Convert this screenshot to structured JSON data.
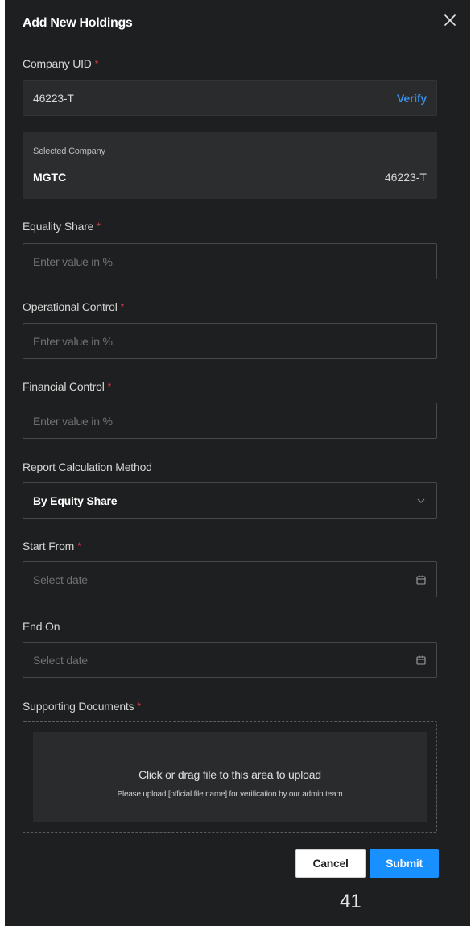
{
  "modal": {
    "title": "Add New Holdings"
  },
  "company_uid": {
    "label": "Company UID",
    "required_mark": "*",
    "value": "46223-T",
    "verify_label": "Verify"
  },
  "selected_company": {
    "caption": "Selected Company",
    "name": "MGTC",
    "code": "46223-T"
  },
  "equality_share": {
    "label": "Equality Share",
    "required_mark": "*",
    "placeholder": "Enter value in %"
  },
  "operational_control": {
    "label": "Operational Control",
    "required_mark": "*",
    "placeholder": "Enter value in %"
  },
  "financial_control": {
    "label": "Financial Control",
    "required_mark": "*",
    "placeholder": "Enter value in %"
  },
  "report_method": {
    "label": "Report Calculation Method",
    "selected": "By Equity Share"
  },
  "start_from": {
    "label": "Start From",
    "required_mark": "*",
    "placeholder": "Select date"
  },
  "end_on": {
    "label": "End On",
    "placeholder": "Select date"
  },
  "supporting_documents": {
    "label": "Supporting Documents",
    "required_mark": "*",
    "upload_text": "Click or drag file to this area to upload",
    "upload_hint": "Please upload [official file name] for verification by our admin team"
  },
  "actions": {
    "cancel_label": "Cancel",
    "submit_label": "Submit"
  },
  "page_number": "41",
  "colors": {
    "panel_bg": "#1e1f20",
    "required": "#e8394a",
    "link": "#3a8ee6",
    "primary": "#1890ff"
  },
  "icons": {
    "close": "close-icon",
    "dropdown": "chevron-down-icon",
    "date": "calendar-icon"
  }
}
